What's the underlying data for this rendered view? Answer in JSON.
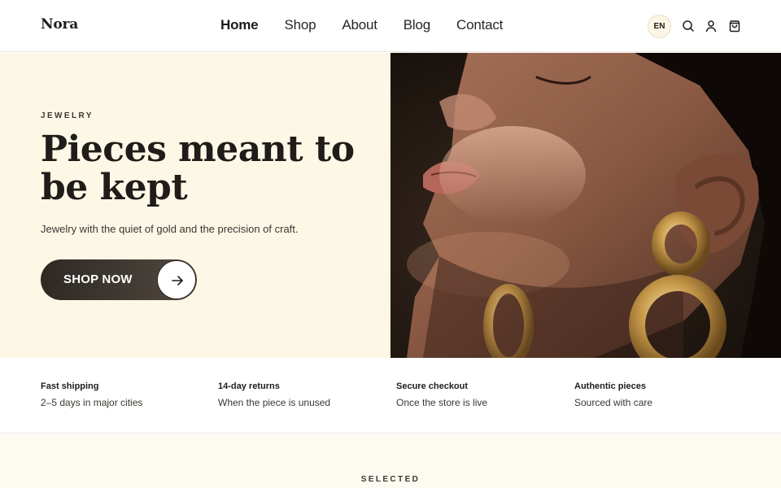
{
  "header": {
    "logo": "Nora",
    "nav": [
      {
        "label": "Home",
        "active": true
      },
      {
        "label": "Shop",
        "active": false
      },
      {
        "label": "About",
        "active": false
      },
      {
        "label": "Blog",
        "active": false
      },
      {
        "label": "Contact",
        "active": false
      }
    ],
    "language": "EN",
    "icons": [
      "search-icon",
      "user-icon",
      "cart-icon"
    ]
  },
  "hero": {
    "eyebrow": "JEWELRY",
    "headline": "Pieces meant to be kept",
    "subline": "Jewelry with the quiet of gold and the precision of craft.",
    "cta_label": "SHOP NOW",
    "cta_icon": "arrow-right-icon",
    "image_alt": "Woman with gold earrings"
  },
  "features": [
    {
      "title": "Fast shipping",
      "desc": "2–5 days in major cities"
    },
    {
      "title": "14-day returns",
      "desc": "When the piece is unused"
    },
    {
      "title": "Secure checkout",
      "desc": "Once the store is live"
    },
    {
      "title": "Authentic pieces",
      "desc": "Sourced with care"
    }
  ],
  "section": {
    "label": "SELECTED"
  },
  "colors": {
    "hero_bg": "#fdf7e6",
    "button_dark": "#2e2924",
    "text": "#1f1c19",
    "gold": "#c89a4a"
  }
}
